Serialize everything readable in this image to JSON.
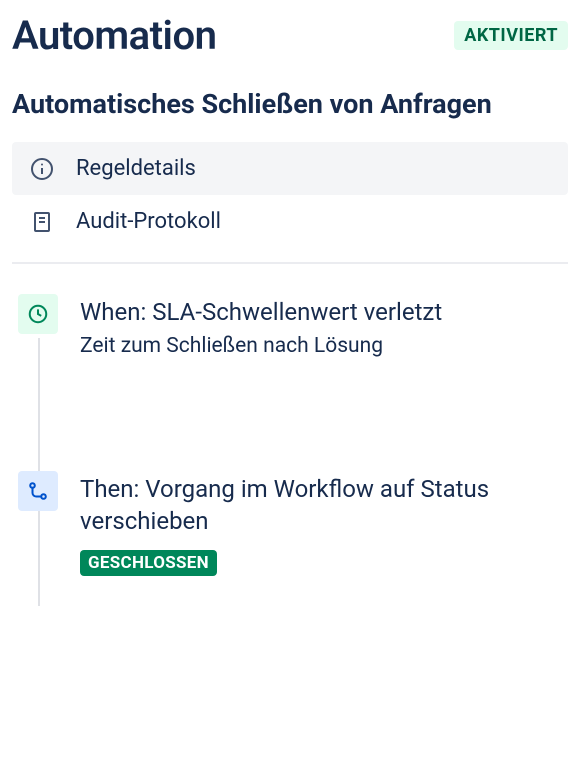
{
  "header": {
    "title": "Automation",
    "status": "AKTIVIERT"
  },
  "rule": {
    "name": "Automatisches Schließen von Anfragen"
  },
  "nav": {
    "details": "Regeldetails",
    "audit": "Audit-Protokoll"
  },
  "flow": {
    "when": {
      "title": "When: SLA-Schwellenwert verletzt",
      "subtitle": "Zeit zum Schließen nach Lösung"
    },
    "then": {
      "title": "Then: Vorgang im Workflow auf Status verschieben",
      "status": "GESCHLOSSEN"
    }
  }
}
